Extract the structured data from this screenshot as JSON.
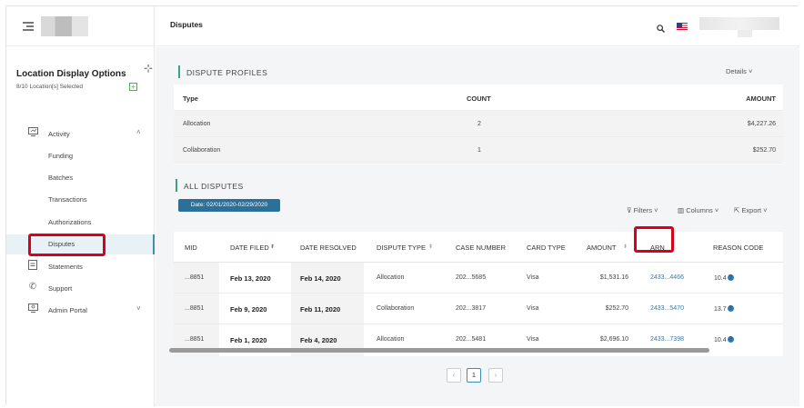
{
  "sidebar": {
    "location_title": "Location Display Options",
    "location_sub": "8/10 Location[s] Selected",
    "items": [
      {
        "label": "Activity",
        "icon": "monitor-icon"
      },
      {
        "label": "Funding"
      },
      {
        "label": "Batches"
      },
      {
        "label": "Transactions"
      },
      {
        "label": "Authorizations"
      },
      {
        "label": "Disputes"
      },
      {
        "label": "Statements",
        "icon": "document-icon"
      },
      {
        "label": "Support",
        "icon": "phone-icon"
      },
      {
        "label": "Admin Portal",
        "icon": "admin-icon"
      }
    ]
  },
  "header": {
    "title": "Disputes"
  },
  "profiles": {
    "heading": "DISPUTE PROFILES",
    "details_label": "Details",
    "columns": [
      "Type",
      "COUNT",
      "AMOUNT"
    ],
    "rows": [
      {
        "type": "Allocation",
        "count": "2",
        "amount": "$4,227.26"
      },
      {
        "type": "Collaboration",
        "count": "1",
        "amount": "$252.70"
      }
    ]
  },
  "disputes": {
    "heading": "ALL DISPUTES",
    "date_range": "Date: 02/01/2020-02/29/2020",
    "filters_label": "Filters",
    "columns_label": "Columns",
    "export_label": "Export",
    "columns": [
      "MID",
      "DATE FILED",
      "DATE RESOLVED",
      "DISPUTE TYPE",
      "CASE NUMBER",
      "CARD TYPE",
      "AMOUNT",
      "ARN",
      "REASON CODE"
    ],
    "rows": [
      {
        "mid": "...8851",
        "filed": "Feb 13, 2020",
        "resolved": "Feb 14, 2020",
        "type": "Allocation",
        "case": "202...5685",
        "card": "Visa",
        "amount": "$1,531.16",
        "arn": "2433...4466",
        "reason": "10.4"
      },
      {
        "mid": "...8851",
        "filed": "Feb 9, 2020",
        "resolved": "Feb 11, 2020",
        "type": "Collaboration",
        "case": "202...3817",
        "card": "Visa",
        "amount": "$252.70",
        "arn": "2433...5470",
        "reason": "13.7"
      },
      {
        "mid": "...8851",
        "filed": "Feb 1, 2020",
        "resolved": "Feb 4, 2020",
        "type": "Allocation",
        "case": "202...5481",
        "card": "Visa",
        "amount": "$2,696.10",
        "arn": "2433...7398",
        "reason": "10.4"
      }
    ]
  },
  "pagination": {
    "current": "1"
  },
  "colors": {
    "accent": "#2c6f99",
    "highlight": "#d9001b",
    "link": "#2e7cb3",
    "section_bar": "#3aa08c"
  }
}
